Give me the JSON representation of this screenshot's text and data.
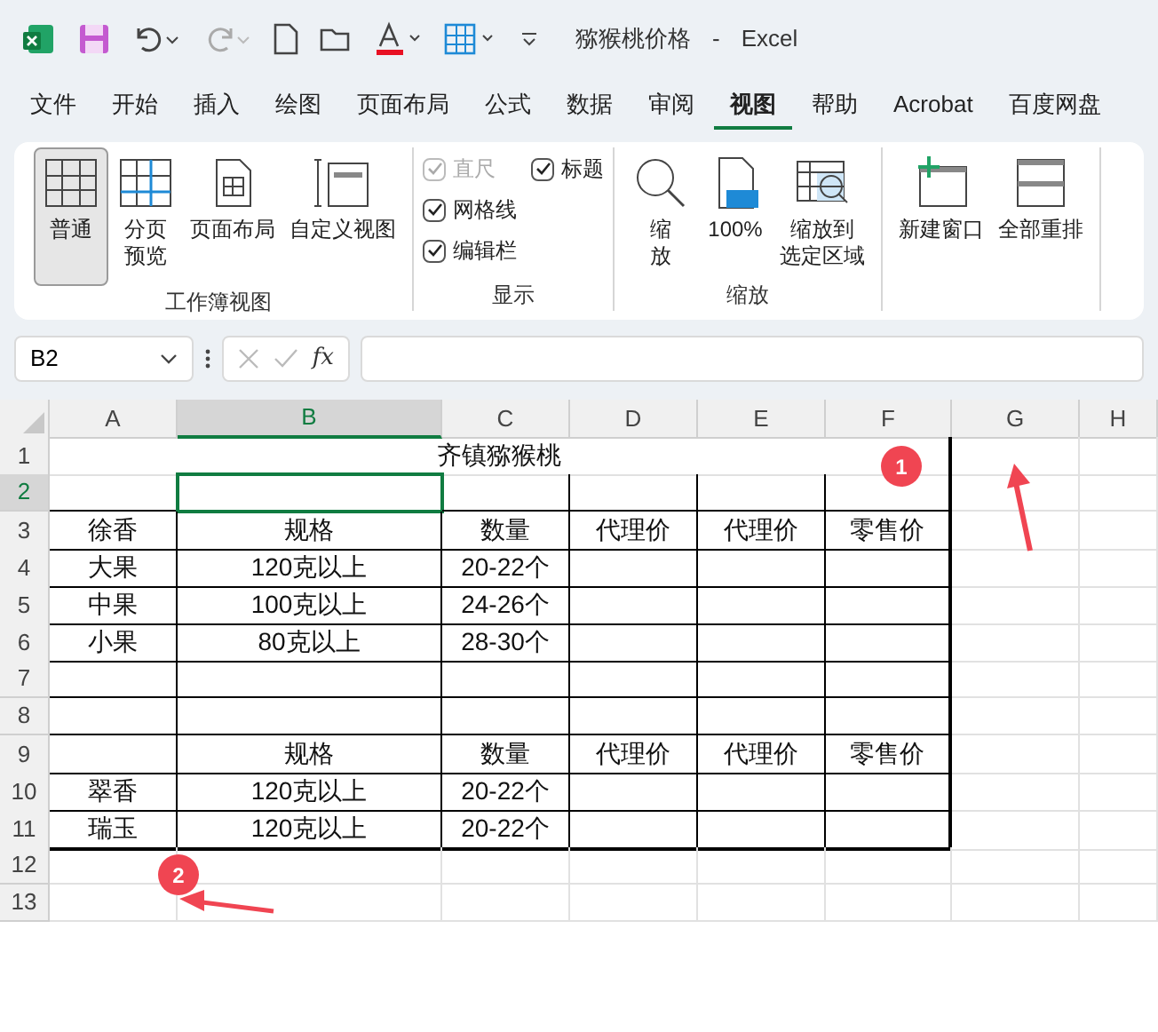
{
  "window": {
    "title": "猕猴桃价格",
    "app": "Excel",
    "separator": "-"
  },
  "tabs": [
    {
      "label": "文件",
      "selected": false
    },
    {
      "label": "开始",
      "selected": false
    },
    {
      "label": "插入",
      "selected": false
    },
    {
      "label": "绘图",
      "selected": false
    },
    {
      "label": "页面布局",
      "selected": false
    },
    {
      "label": "公式",
      "selected": false
    },
    {
      "label": "数据",
      "selected": false
    },
    {
      "label": "审阅",
      "selected": false
    },
    {
      "label": "视图",
      "selected": true
    },
    {
      "label": "帮助",
      "selected": false
    },
    {
      "label": "Acrobat",
      "selected": false
    },
    {
      "label": "百度网盘",
      "selected": false
    }
  ],
  "ribbon": {
    "groups": [
      {
        "title": "工作簿视图",
        "kind": "buttons",
        "items": [
          {
            "lines": [
              "普通"
            ],
            "selected": true
          },
          {
            "lines": [
              "分页",
              "预览"
            ],
            "selected": false
          },
          {
            "lines": [
              "页面布局"
            ],
            "selected": false
          },
          {
            "lines": [
              "自定义视图"
            ],
            "selected": false
          }
        ]
      },
      {
        "title": "显示",
        "kind": "checks",
        "items": [
          {
            "label": "直尺",
            "checked": true,
            "disabled": true
          },
          {
            "label": "网格线",
            "checked": true,
            "disabled": false
          },
          {
            "label": "编辑栏",
            "checked": true,
            "disabled": false
          },
          {
            "label": "标题",
            "checked": true,
            "disabled": false
          }
        ]
      },
      {
        "title": "缩放",
        "kind": "buttons",
        "items": [
          {
            "lines": [
              "缩",
              "放"
            ],
            "selected": false
          },
          {
            "lines": [
              "100%"
            ],
            "selected": false
          },
          {
            "lines": [
              "缩放到",
              "选定区域"
            ],
            "selected": false
          }
        ]
      },
      {
        "kind": "buttons",
        "items": [
          {
            "lines": [
              "新建窗口"
            ],
            "selected": false
          },
          {
            "lines": [
              "全部重排"
            ],
            "selected": false
          }
        ]
      }
    ]
  },
  "formula_bar": {
    "name_box": "B2",
    "fx": "fx"
  },
  "columns": [
    {
      "label": "A",
      "selected": false
    },
    {
      "label": "B",
      "selected": true
    },
    {
      "label": "C",
      "selected": false
    },
    {
      "label": "D",
      "selected": false
    },
    {
      "label": "E",
      "selected": false
    },
    {
      "label": "F",
      "selected": false
    },
    {
      "label": "G",
      "selected": false
    },
    {
      "label": "H",
      "selected": false
    }
  ],
  "rows": [
    {
      "number": "1",
      "selected": false,
      "merged": true,
      "cells": {
        "A": "齐镇猕猴桃"
      }
    },
    {
      "number": "2",
      "selected": true,
      "cells": {}
    },
    {
      "number": "3",
      "selected": false,
      "cells": {
        "A": "徐香",
        "B": "规格",
        "C": "数量",
        "D": "代理价",
        "E": "代理价",
        "F": "零售价"
      }
    },
    {
      "number": "4",
      "selected": false,
      "cells": {
        "A": "大果",
        "B": "120克以上",
        "C": "20-22个"
      }
    },
    {
      "number": "5",
      "selected": false,
      "cells": {
        "A": "中果",
        "B": "100克以上",
        "C": "24-26个"
      }
    },
    {
      "number": "6",
      "selected": false,
      "cells": {
        "A": "小果",
        "B": "80克以上",
        "C": "28-30个"
      }
    },
    {
      "number": "7",
      "selected": false,
      "cells": {}
    },
    {
      "number": "8",
      "selected": false,
      "cells": {}
    },
    {
      "number": "9",
      "selected": false,
      "cells": {
        "B": "规格",
        "C": "数量",
        "D": "代理价",
        "E": "代理价",
        "F": "零售价"
      }
    },
    {
      "number": "10",
      "selected": false,
      "cells": {
        "A": "翠香",
        "B": "120克以上",
        "C": "20-22个"
      }
    },
    {
      "number": "11",
      "selected": false,
      "cells": {
        "A": "瑞玉",
        "B": "120克以上",
        "C": "20-22个"
      }
    },
    {
      "number": "12",
      "selected": false,
      "cells": {}
    },
    {
      "number": "13",
      "selected": false,
      "cells": {}
    }
  ],
  "annotations": [
    {
      "label": "1"
    },
    {
      "label": "2"
    }
  ]
}
